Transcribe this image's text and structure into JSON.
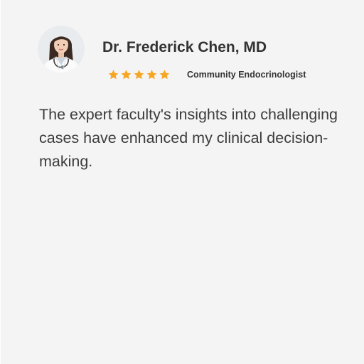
{
  "testimonial": {
    "name": "Dr. Frederick Chen, MD",
    "role": "Community Endocrinologist",
    "rating": 5,
    "rating_max": 5,
    "quote": "The expert faculty's insights into challenging cases have enhanced my clinical decision-making.",
    "avatar_icon": "doctor-portrait",
    "star_color": "#f5a623",
    "background_color": "#f4f4f4"
  }
}
